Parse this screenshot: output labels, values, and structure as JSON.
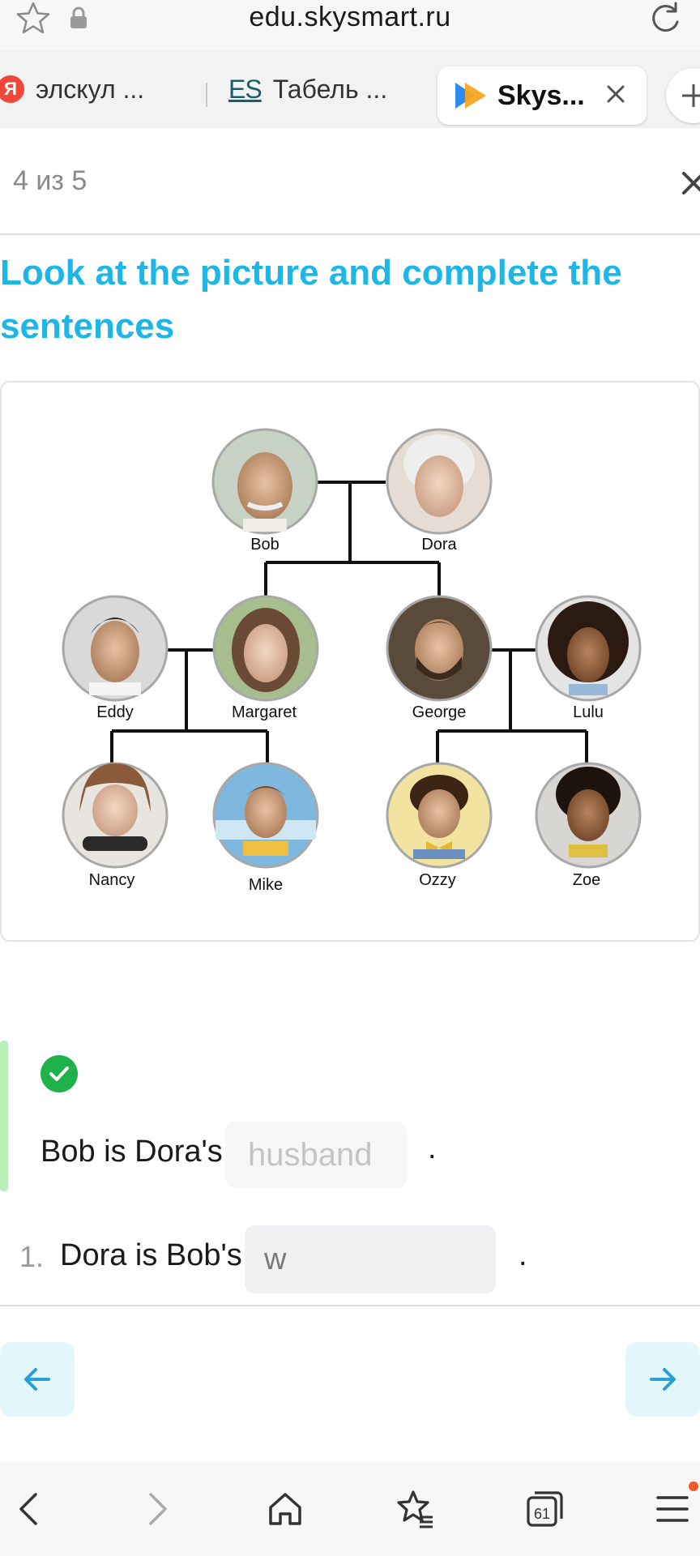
{
  "browser": {
    "url": "edu.skysmart.ru",
    "tabs": [
      {
        "label": "элскул ...",
        "icon": "yandex-icon",
        "icon_text": "Я"
      },
      {
        "label": "Табель ...",
        "icon": "es-icon",
        "icon_text": "ES"
      },
      {
        "label": "Skys...",
        "icon": "skysmart-icon",
        "active": true
      }
    ],
    "tab_count": "61"
  },
  "task": {
    "progress": "4 из 5",
    "title": "Look at the picture and complete the sentences"
  },
  "family_tree": {
    "people": [
      {
        "name": "Bob"
      },
      {
        "name": "Dora"
      },
      {
        "name": "Eddy"
      },
      {
        "name": "Margaret"
      },
      {
        "name": "George"
      },
      {
        "name": "Lulu"
      },
      {
        "name": "Nancy"
      },
      {
        "name": "Mike"
      },
      {
        "name": "Ozzy"
      },
      {
        "name": "Zoe"
      }
    ]
  },
  "example": {
    "sentence": "Bob is Dora's",
    "answer": "husband",
    "end": ".",
    "status": "correct"
  },
  "question": {
    "number": "1.",
    "sentence": "Dora is Bob's",
    "value": "w",
    "end": "."
  },
  "colors": {
    "title": "#1cb6e8",
    "check": "#1fb14a",
    "nav_bg": "#e3f6fc",
    "nav_arrow": "#2a9fd8"
  }
}
